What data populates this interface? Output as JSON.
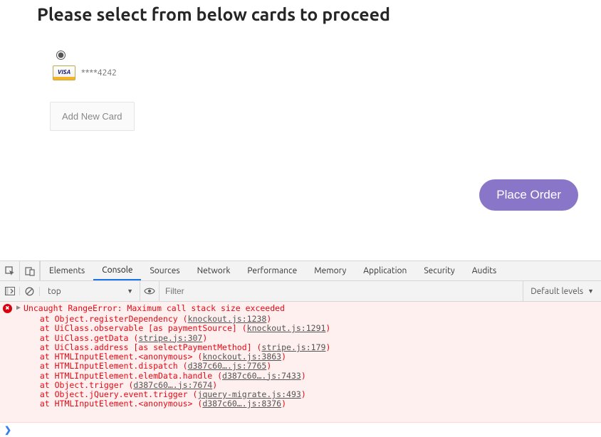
{
  "page": {
    "heading": "Please select from below cards to proceed",
    "card": {
      "brand_text": "VISA",
      "masked": "****4242"
    },
    "add_card_label": "Add New Card",
    "place_order_label": "Place Order"
  },
  "devtools": {
    "tabs": [
      "Elements",
      "Console",
      "Sources",
      "Network",
      "Performance",
      "Memory",
      "Application",
      "Security",
      "Audits"
    ],
    "active_tab": "Console",
    "context": "top",
    "filter_placeholder": "Filter",
    "levels_label": "Default levels",
    "error": {
      "message": "Uncaught RangeError: Maximum call stack size exceeded",
      "stack": [
        {
          "text": "at Object.registerDependency",
          "link": "knockout.js:1238"
        },
        {
          "text": "at UiClass.observable [as paymentSource]",
          "link": "knockout.js:1291"
        },
        {
          "text": "at UiClass.getData",
          "link": "stripe.js:307"
        },
        {
          "text": "at UiClass.address [as selectPaymentMethod]",
          "link": "stripe.js:179"
        },
        {
          "text": "at HTMLInputElement.<anonymous>",
          "link": "knockout.js:3863"
        },
        {
          "text": "at HTMLInputElement.dispatch",
          "link": "d387c60….js:7765"
        },
        {
          "text": "at HTMLInputElement.elemData.handle",
          "link": "d387c60….js:7433"
        },
        {
          "text": "at Object.trigger",
          "link": "d387c60….js:7674"
        },
        {
          "text": "at Object.jQuery.event.trigger",
          "link": "jquery-migrate.js:493"
        },
        {
          "text": "at HTMLInputElement.<anonymous>",
          "link": "d387c60….js:8376"
        }
      ]
    }
  }
}
